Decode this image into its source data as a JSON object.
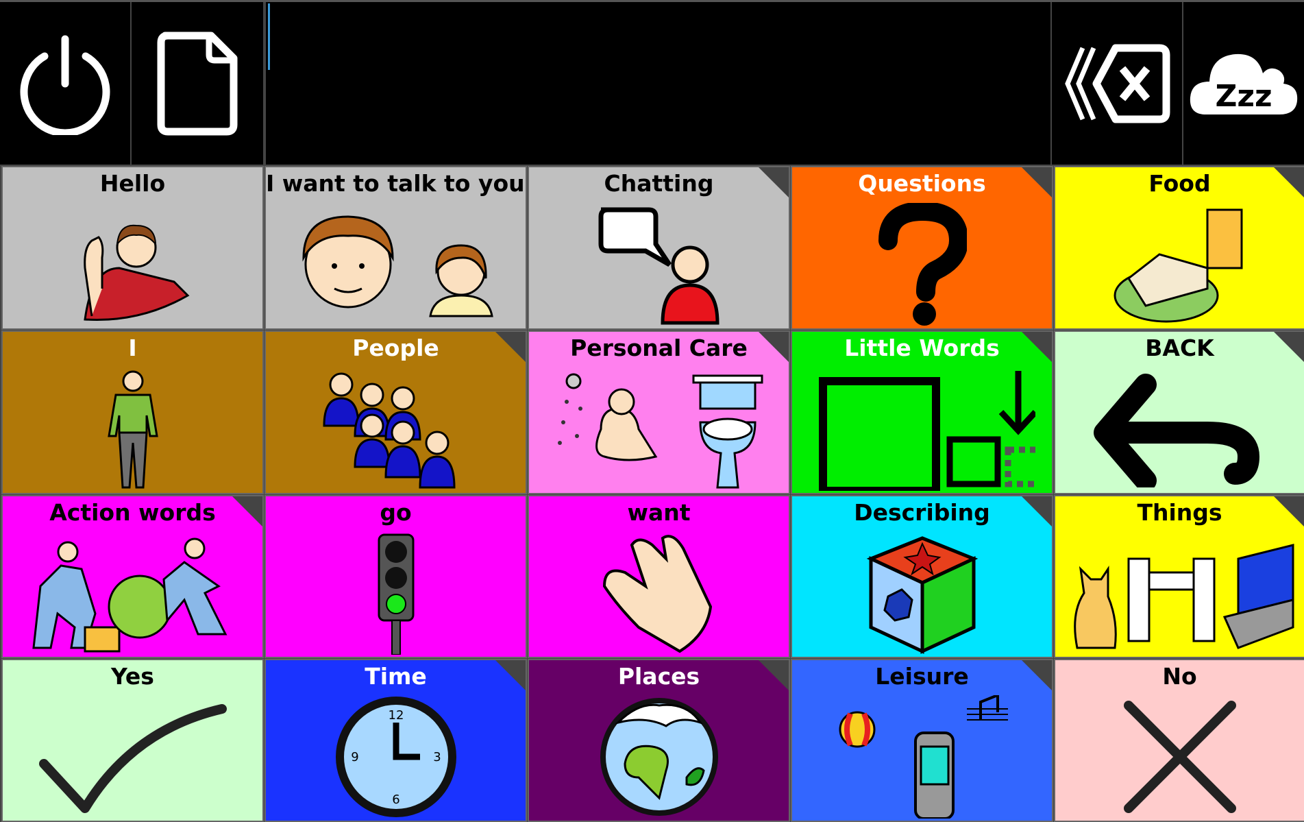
{
  "topbar": {
    "buttons_left": [
      {
        "name": "power-button",
        "icon": "power-icon"
      },
      {
        "name": "new-document-button",
        "icon": "document-icon"
      }
    ],
    "message_text": "",
    "buttons_right": [
      {
        "name": "clear-button",
        "icon": "backspace-clear-icon"
      },
      {
        "name": "sleep-button",
        "icon": "cloud-zzz-icon",
        "icon_text": "Zzz"
      }
    ]
  },
  "grid": {
    "cells": [
      {
        "label": "Hello",
        "bg": "#c0c0c0",
        "fg": "#000000",
        "folder": false,
        "icon": "waving-person-icon"
      },
      {
        "label": "I want to talk to you.",
        "bg": "#c0c0c0",
        "fg": "#000000",
        "folder": false,
        "icon": "two-faces-icon"
      },
      {
        "label": "Chatting",
        "bg": "#c0c0c0",
        "fg": "#000000",
        "folder": true,
        "icon": "speech-bubble-person-icon"
      },
      {
        "label": "Questions",
        "bg": "#ff6600",
        "fg": "#ffffff",
        "folder": true,
        "icon": "question-mark-icon"
      },
      {
        "label": "Food",
        "bg": "#ffff00",
        "fg": "#000000",
        "folder": true,
        "icon": "sandwich-drink-icon"
      },
      {
        "label": "I",
        "bg": "#b07808",
        "fg": "#ffffff",
        "folder": false,
        "icon": "standing-person-icon"
      },
      {
        "label": "People",
        "bg": "#b07808",
        "fg": "#ffffff",
        "folder": true,
        "icon": "group-of-people-icon"
      },
      {
        "label": "Personal Care",
        "bg": "#ff80ee",
        "fg": "#000000",
        "folder": true,
        "icon": "shower-toilet-icon"
      },
      {
        "label": "Little Words",
        "bg": "#00ee00",
        "fg": "#ffffff",
        "folder": true,
        "icon": "squares-arrow-icon"
      },
      {
        "label": "BACK",
        "bg": "#ccffcc",
        "fg": "#000000",
        "folder": true,
        "icon": "back-arrow-icon"
      },
      {
        "label": "Action words",
        "bg": "#ff00ff",
        "fg": "#000000",
        "folder": true,
        "icon": "action-people-icon"
      },
      {
        "label": "go",
        "bg": "#ff00ff",
        "fg": "#000000",
        "folder": false,
        "icon": "traffic-light-icon"
      },
      {
        "label": "want",
        "bg": "#ff00ff",
        "fg": "#000000",
        "folder": false,
        "icon": "reaching-hand-icon"
      },
      {
        "label": "Describing",
        "bg": "#00e5ff",
        "fg": "#000000",
        "folder": true,
        "icon": "shape-cube-icon"
      },
      {
        "label": "Things",
        "bg": "#ffff00",
        "fg": "#000000",
        "folder": true,
        "icon": "cat-table-laptop-icon"
      },
      {
        "label": "Yes",
        "bg": "#ccffcc",
        "fg": "#000000",
        "folder": false,
        "icon": "check-icon"
      },
      {
        "label": "Time",
        "bg": "#1a33ff",
        "fg": "#ffffff",
        "folder": true,
        "icon": "clock-icon",
        "icon_text": [
          "12",
          "3",
          "6",
          "9"
        ]
      },
      {
        "label": "Places",
        "bg": "#660066",
        "fg": "#ffffff",
        "folder": true,
        "icon": "globe-icon"
      },
      {
        "label": "Leisure",
        "bg": "#3366ff",
        "fg": "#000000",
        "folder": true,
        "icon": "ball-phone-music-icon"
      },
      {
        "label": "No",
        "bg": "#ffcccc",
        "fg": "#000000",
        "folder": false,
        "icon": "cross-icon"
      }
    ]
  }
}
